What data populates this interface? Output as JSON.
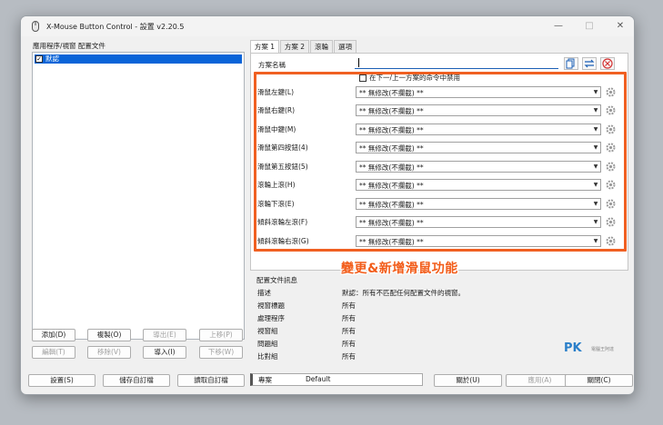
{
  "window": {
    "title": "X-Mouse Button Control - 設置 v2.20.5"
  },
  "left_panel": {
    "label": "應用程序/視窗 配置文件",
    "items": [
      {
        "label": "默認",
        "checked": true
      }
    ]
  },
  "list_buttons": {
    "add": "添加(D)",
    "copy": "複製(O)",
    "export": "導出(E)",
    "move_up": "上移(P)",
    "edit": "編輯(T)",
    "remove": "移除(V)",
    "import": "導入(I)",
    "move_down": "下移(W)"
  },
  "tabs": [
    "方案 1",
    "方案 2",
    "滾輪",
    "選項"
  ],
  "profile_name_label": "方案名稱",
  "disable_check_label": "在下一/上一方案的命令中禁用",
  "actions": [
    {
      "label": "滑鼠左鍵(L)",
      "value": "** 無修改(不攔截) **"
    },
    {
      "label": "滑鼠右鍵(R)",
      "value": "** 無修改(不攔截) **"
    },
    {
      "label": "滑鼠中鍵(M)",
      "value": "** 無修改(不攔截) **"
    },
    {
      "label": "滑鼠第四按鈕(4)",
      "value": "** 無修改(不攔截) **"
    },
    {
      "label": "滑鼠第五按鈕(5)",
      "value": "** 無修改(不攔截) **"
    },
    {
      "label": "滾輪上滾(H)",
      "value": "** 無修改(不攔截) **"
    },
    {
      "label": "滾輪下滾(E)",
      "value": "** 無修改(不攔截) **"
    },
    {
      "label": "傾斜滾輪左滾(F)",
      "value": "** 無修改(不攔截) **"
    },
    {
      "label": "傾斜滾輪右滾(G)",
      "value": "** 無修改(不攔截) **"
    }
  ],
  "annotation": "變更&新增滑鼠功能",
  "info": {
    "title": "配置文件訊息",
    "rows": [
      {
        "key": "描述",
        "value": "默認：所有不匹配任何配置文件的視窗。"
      },
      {
        "key": "視窗標題",
        "value": "所有"
      },
      {
        "key": "處理程序",
        "value": "所有"
      },
      {
        "key": "視窗組",
        "value": "所有"
      },
      {
        "key": "問題組",
        "value": "所有"
      },
      {
        "key": "比對組",
        "value": "所有"
      }
    ]
  },
  "watermark": {
    "logo": "PK",
    "sub": "電腦王阿達"
  },
  "bottom_buttons": {
    "settings": "設置(S)",
    "save_custom": "儲存自訂檔",
    "load_custom": "讀取自訂檔",
    "about": "關於(U)",
    "apply": "應用(A)",
    "close": "關閉(C)"
  },
  "status": {
    "label": "專案",
    "value": "Default"
  },
  "colors": {
    "highlight": "#f06022",
    "selection": "#0a64d8",
    "annotation": "#f25c19"
  }
}
